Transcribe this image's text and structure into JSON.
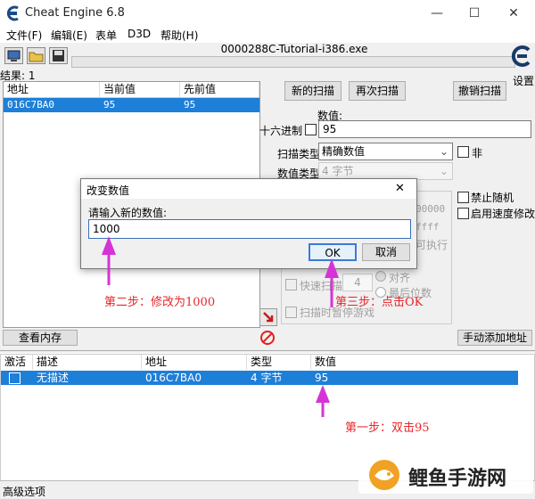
{
  "window": {
    "title": "Cheat Engine 6.8",
    "minimize": "—",
    "maximize": "☐",
    "close": "✕"
  },
  "menu": [
    "文件(F)",
    "编辑(E)",
    "表单",
    "D3D",
    "帮助(H)"
  ],
  "process_name": "0000288C-Tutorial-i386.exe",
  "settings_label": "设置",
  "results_label": "结果: 1",
  "result_list": {
    "headers": [
      "地址",
      "当前值",
      "先前值"
    ],
    "rows": [
      {
        "address": "016C7BA0",
        "current": "95",
        "previous": "95"
      }
    ]
  },
  "scan": {
    "new_scan": "新的扫描",
    "next_scan": "再次扫描",
    "undo_scan": "撤销扫描",
    "value_label": "数值:",
    "hex_label": "十六进制",
    "value": "95",
    "scan_type_label": "扫描类型",
    "scan_type_value": "精确数值",
    "not_label": "非",
    "value_type_label": "数值类型",
    "value_type_value": "4 字节",
    "disable_random": "禁止随机",
    "enable_speedhack": "启用速度修改",
    "hidden_zeros": "00000",
    "hidden_fs": "ffff",
    "executable": "可执行",
    "fast_scan": "快速扫描",
    "fast_scan_value": "4",
    "align": "对齐",
    "last_digits": "最后位数",
    "pause_game": "扫描时暂停游戏"
  },
  "dialog": {
    "title": "改变数值",
    "prompt": "请输入新的数值:",
    "value": "1000",
    "ok": "OK",
    "cancel": "取消",
    "close": "✕"
  },
  "view_memory": "查看内存",
  "add_address_manually": "手动添加地址",
  "cheat_table": {
    "headers": [
      "激活",
      "描述",
      "地址",
      "类型",
      "数值"
    ],
    "rows": [
      {
        "active": false,
        "description": "无描述",
        "address": "016C7BA0",
        "type": "4 字节",
        "value": "95"
      }
    ]
  },
  "advanced_options": "高级选项",
  "annotations": {
    "step1": "第一步：双击95",
    "step2": "第二步：修改为1000",
    "step3": "第三步：点击OK"
  },
  "watermark": "鲤鱼手游网",
  "colors": {
    "selection": "#1e7fd8",
    "annotation": "#e8262b",
    "arrow": "#d633d6"
  }
}
